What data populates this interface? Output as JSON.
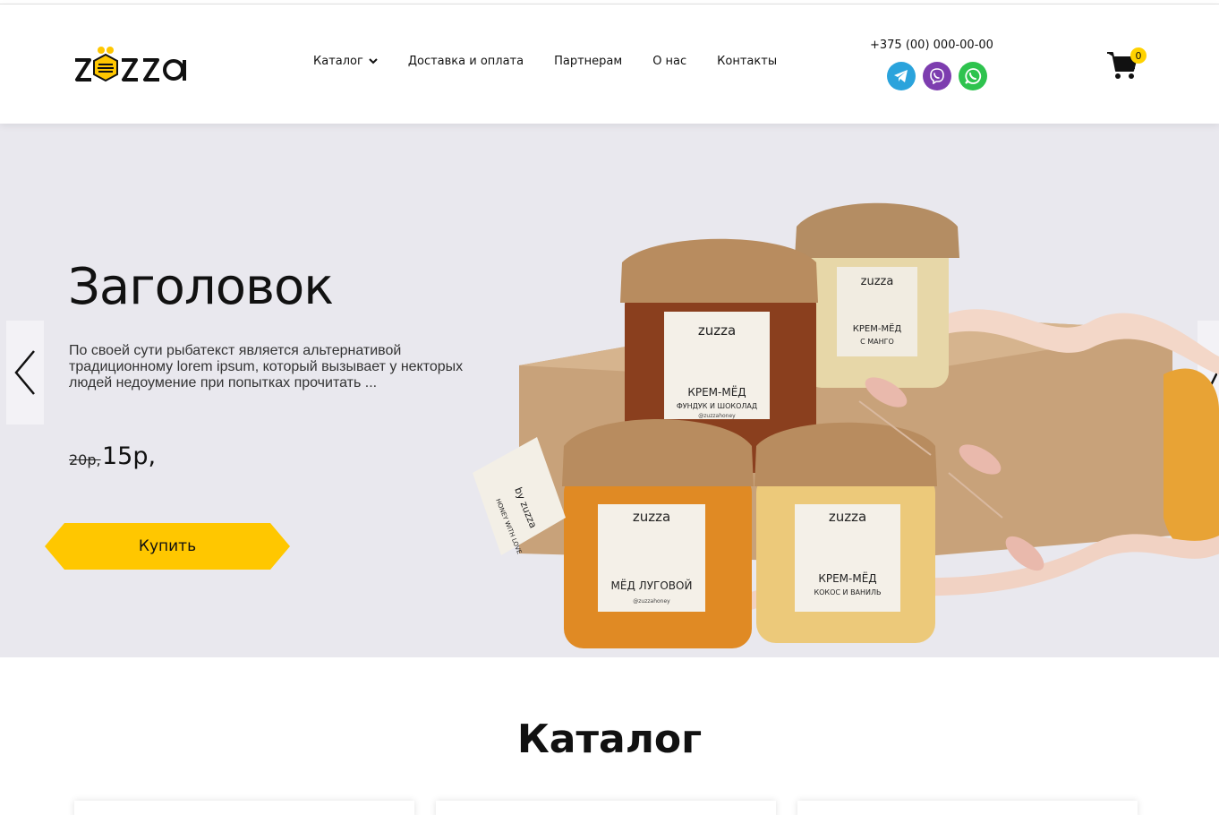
{
  "brand": {
    "logo_text": "zuzza",
    "accent": "#ffc700"
  },
  "nav": {
    "items": [
      {
        "label": "Каталог",
        "has_dropdown": true
      },
      {
        "label": "Доставка и оплата"
      },
      {
        "label": "Партнерам"
      },
      {
        "label": "О нас"
      },
      {
        "label": "Контакты"
      }
    ]
  },
  "contacts": {
    "phone": "+375 (00) 000-00-00",
    "socials": [
      {
        "icon": "telegram-icon",
        "color": "#2aa3dc"
      },
      {
        "icon": "viber-icon",
        "color": "#7d3daf"
      },
      {
        "icon": "whatsapp-icon",
        "color": "#2ec34e"
      }
    ]
  },
  "cart": {
    "count": "0",
    "icon": "cart-icon"
  },
  "hero": {
    "title": "Заголовок",
    "description": "По своей сути рыбатекст является альтернативой традиционному lorem ipsum, который вызывает у некторых людей недоумение при попытках прочитать ...",
    "old_price": "20р,",
    "new_price": "15р,",
    "buy_label": "Купить",
    "jar_labels": {
      "top_left": {
        "brand": "zuzza",
        "name": "КРЕМ-МЁД",
        "flavor": "ФУНДУК И ШОКОЛАД",
        "handle": "@zuzzahoney"
      },
      "top_right": {
        "brand": "zuzza",
        "name": "КРЕМ-МЁД",
        "flavor": "С МАНГО"
      },
      "bottom_left": {
        "brand": "zuzza",
        "name": "МЁД ЛУГОВОЙ",
        "handle": "@zuzzahoney"
      },
      "bottom_right": {
        "brand": "zuzza",
        "name": "КРЕМ-МЁД",
        "flavor": "КОКОС И ВАНИЛЬ"
      },
      "tag": {
        "line1": "by zuzza",
        "line2": "HONEY WITH LOVE"
      }
    }
  },
  "catalog": {
    "title": "Каталог"
  }
}
